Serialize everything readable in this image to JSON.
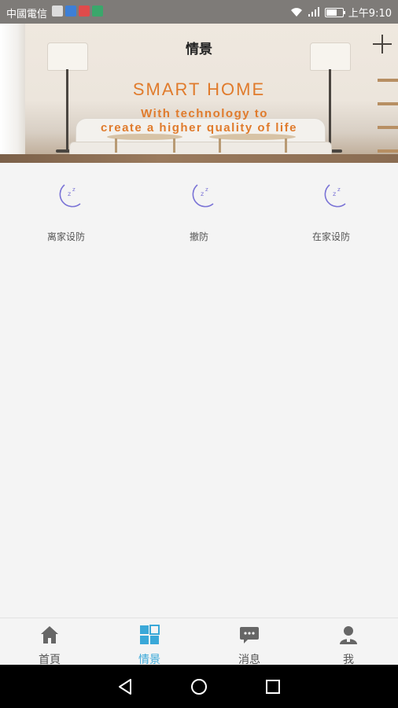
{
  "status_bar": {
    "carrier": "中國電信",
    "time": "上午9:10",
    "icons": [
      "image-icon",
      "shield-icon",
      "home-red-icon",
      "home-green-icon"
    ]
  },
  "header": {
    "title": "情景",
    "add_icon": "plus-icon"
  },
  "banner": {
    "headline": "SMART HOME",
    "line1": "With technology to",
    "line2": "create a higher quality of life",
    "text_color": "#e07b2c"
  },
  "scenes": [
    {
      "label": "离家设防",
      "icon": "moon-sleep-icon"
    },
    {
      "label": "撤防",
      "icon": "moon-sleep-icon"
    },
    {
      "label": "在家设防",
      "icon": "moon-sleep-icon"
    }
  ],
  "scene_icon_color": "#7a73d6",
  "tabs": [
    {
      "label": "首頁",
      "icon": "home-icon",
      "active": false
    },
    {
      "label": "情景",
      "icon": "grid-icon",
      "active": true
    },
    {
      "label": "消息",
      "icon": "message-icon",
      "active": false
    },
    {
      "label": "我",
      "icon": "user-icon",
      "active": false
    }
  ],
  "colors": {
    "active_tab": "#3aa8d8",
    "inactive_tab": "#666666"
  }
}
